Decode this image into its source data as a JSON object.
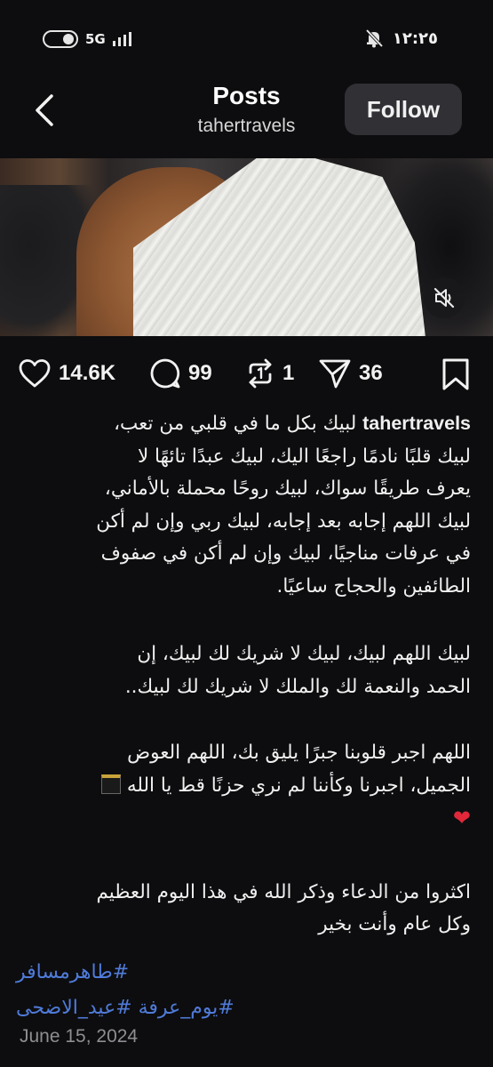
{
  "status_bar": {
    "network": "5G",
    "time": "١٢:٢٥"
  },
  "header": {
    "title": "Posts",
    "username": "tahertravels",
    "follow_label": "Follow"
  },
  "media": {
    "description_icon": "muted-speaker-icon"
  },
  "actions": {
    "likes": "14.6K",
    "comments": "99",
    "reposts": "1",
    "shares": "36"
  },
  "caption": {
    "author": "tahertravels",
    "p1_l1": "لبيك بكل ما في قلبي من تعب،",
    "p1_l2": "لبيك قلبًا نادمًا راجعًا اليك، لبيك عبدًا تائهًا لا",
    "p1_l3": "يعرف طريقًا سواك، لبيك روحًا محملة بالأماني،",
    "p1_l4": "لبيك اللهم إجابه بعد إجابه، لبيك ربي وإن لم أكن",
    "p1_l5": "في عرفات مناجيًا، لبيك وإن لم أكن في صفوف",
    "p1_l6": "الطائفين والحجاج ساعيًا.",
    "p2_l1": "لبيك اللهم لبيك، لبيك لا شريك لك لبيك، إن",
    "p2_l2": "الحمد والنعمة لك والملك لا شريك لك لبيك..",
    "p3_l1": "اللهم اجبر قلوبنا جبرًا يليق بك، اللهم العوض",
    "p3_l2": "الجميل، اجبرنا وكأننا لم نري حزنًا قط يا الله",
    "p4_l1": "اكثروا من الدعاء وذكر الله في هذا اليوم العظيم",
    "p4_l2": "وكل عام وأنت بخير"
  },
  "hashtags": {
    "line1": "#طاهرمسافر",
    "line2": "#يوم_عرفة #عيد_الاضحى"
  },
  "post_date": "June 15, 2024",
  "colors": {
    "background": "#0d0d0f",
    "hashtag": "#4f7bd9",
    "follow_button": "#303035",
    "heart_emoji": "#e0283a"
  }
}
